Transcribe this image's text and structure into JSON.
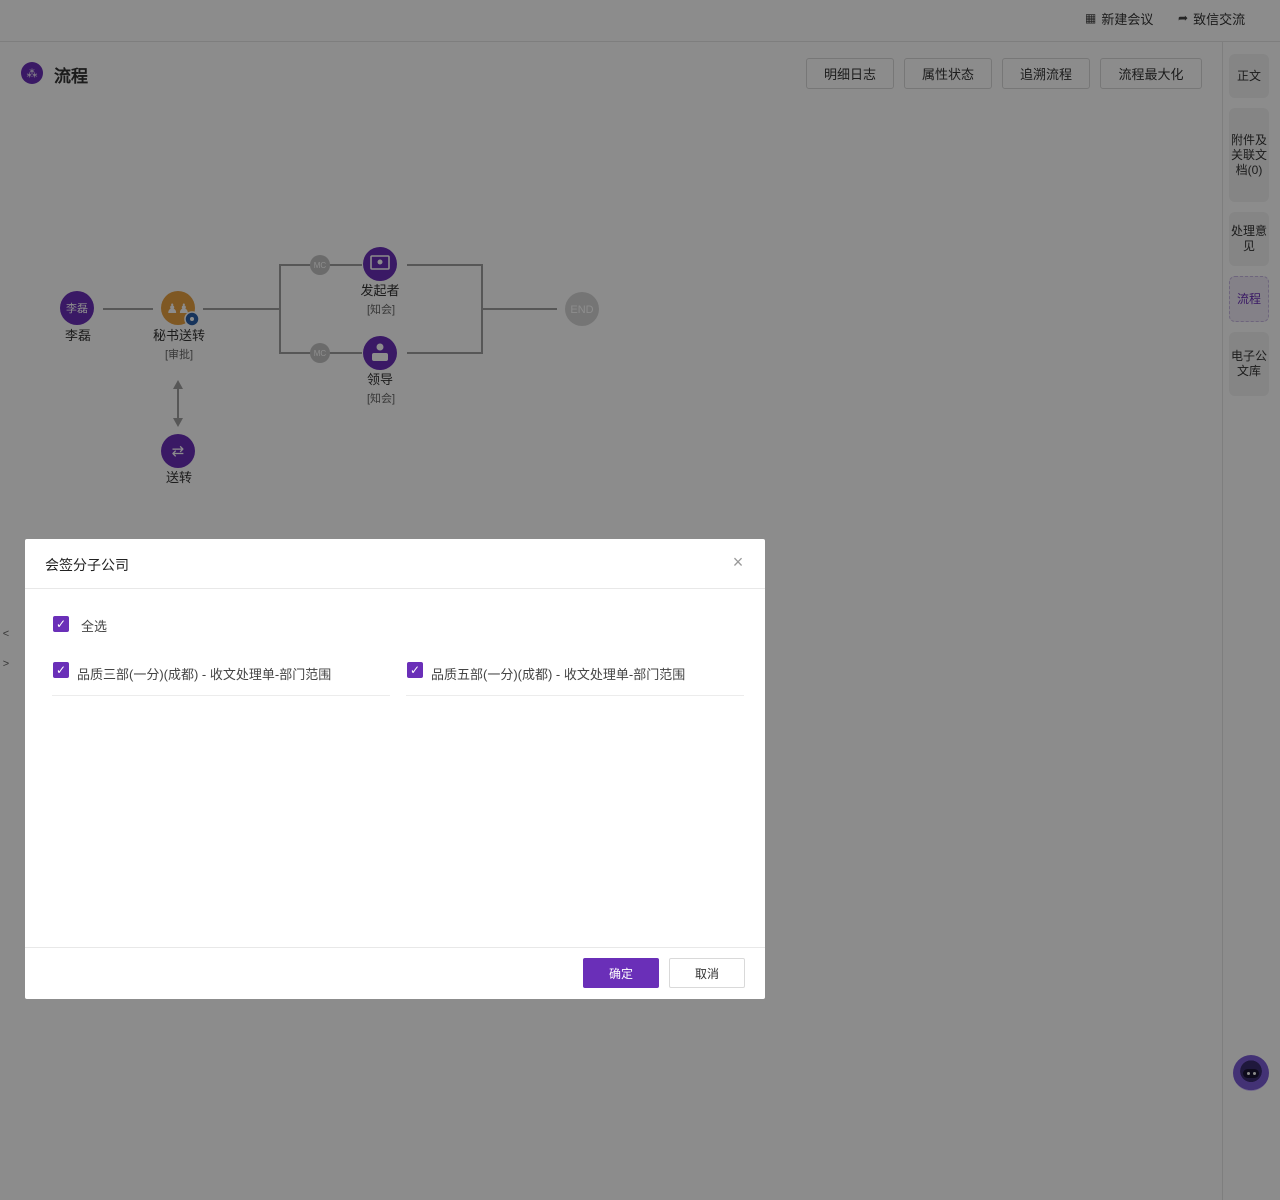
{
  "topbar": {
    "new_meeting": {
      "icon": "meeting-icon",
      "label": "新建会议"
    },
    "letter_exchange": {
      "icon": "speech-bubble-icon",
      "label": "致信交流"
    }
  },
  "flow_panel": {
    "title": "流程",
    "title_icon_glyph": "⁂",
    "buttons": [
      "明细日志",
      "属性状态",
      "追溯流程",
      "流程最大化"
    ]
  },
  "flow_diagram": {
    "nodes": {
      "start": {
        "avatar_text": "李磊",
        "label": "李磊"
      },
      "secretary": {
        "label": "秘书送转",
        "sublabel": "[审批]"
      },
      "initiator": {
        "label": "发起者",
        "sublabel": "[知会]"
      },
      "leader": {
        "label": "领导",
        "sublabel": "[知会]"
      },
      "transfer": {
        "label": "送转"
      },
      "end": {
        "label": "END"
      },
      "mc_top": {
        "label": "MC"
      },
      "mc_bottom": {
        "label": "MC"
      }
    },
    "colors": {
      "purple": "#6a2fb8",
      "orange": "#e8a040",
      "grey": "#d6d6d6",
      "line": "#9e9e9e"
    }
  },
  "right_rail": {
    "tabs": [
      {
        "label": "正文",
        "active": false
      },
      {
        "label": "附件及关联文档(0)",
        "active": false
      },
      {
        "label": "处理意见",
        "active": false
      },
      {
        "label": "流程",
        "active": true
      },
      {
        "label": "电子公文库",
        "active": false
      }
    ]
  },
  "side_handles": {
    "collapse": "<",
    "expand": ">"
  },
  "dialog": {
    "title": "会签分子公司",
    "close_glyph": "×",
    "select_all": {
      "label": "全选",
      "checked": true
    },
    "options": [
      {
        "label": "品质三部(一分)(成都) - 收文处理单-部门范围",
        "checked": true
      },
      {
        "label": "品质五部(一分)(成都) - 收文处理单-部门范围",
        "checked": true
      }
    ],
    "confirm_label": "确定",
    "cancel_label": "取消",
    "check_glyph": "✓"
  },
  "accent_color": "#6a2fb8"
}
